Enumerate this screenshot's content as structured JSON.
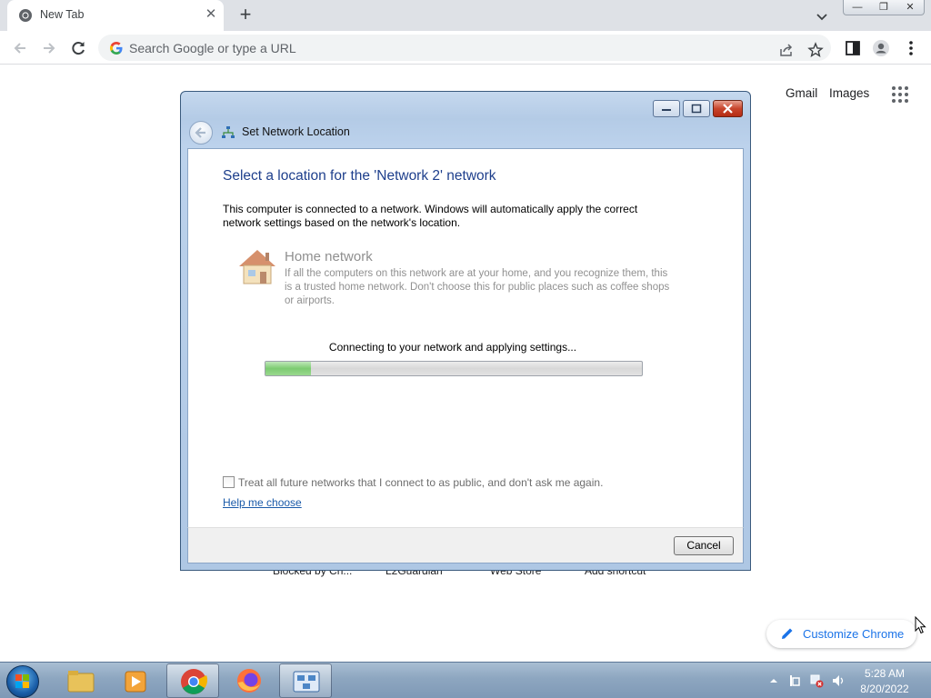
{
  "browser": {
    "tab": {
      "title": "New Tab",
      "close_glyph": "✕"
    },
    "new_tab_glyph": "+",
    "window_controls": {
      "minimize": "—",
      "restore": "❐",
      "close": "✕"
    },
    "omnibox": {
      "placeholder": "Search Google or type a URL"
    },
    "icons": [
      "chrome-favicon",
      "tab-search-icon",
      "back-arrow-icon",
      "forward-arrow-icon",
      "reload-icon",
      "google-g-icon",
      "share-icon",
      "bookmark-star-icon",
      "side-panel-icon",
      "profile-icon",
      "kebab-menu-icon"
    ]
  },
  "ntp": {
    "gmail": "Gmail",
    "images": "Images",
    "shortcuts": [
      "Blocked by Ch...",
      "L2Guardian",
      "Web Store",
      "Add shortcut"
    ],
    "customize": "Customize Chrome"
  },
  "dialog": {
    "title": "Set Network Location",
    "heading": "Select a location for the 'Network  2' network",
    "description": "This computer is connected to a network. Windows will automatically apply the correct network settings based on the network's location.",
    "option": {
      "title": "Home network",
      "description": "If all the computers on this network are at your home, and you recognize them, this is a trusted home network.  Don't choose this for public places such as coffee shops or airports."
    },
    "progress_text": "Connecting to your network and applying settings...",
    "progress": 0.12,
    "checkbox_label": "Treat all future networks that I connect to as public, and don't ask me again.",
    "checkbox_checked": false,
    "help_link": "Help me choose",
    "cancel": "Cancel"
  },
  "taskbar": {
    "items": [
      "windows-explorer",
      "media-player",
      "google-chrome",
      "firefox",
      "network-wizard"
    ],
    "active_item": "network-wizard",
    "clock": {
      "time": "5:28 AM",
      "date": "8/20/2022"
    }
  },
  "colors": {
    "link_blue": "#1a73e8",
    "heading_blue": "#1e3f8c",
    "dialog_frame": "#b4cbe6"
  }
}
